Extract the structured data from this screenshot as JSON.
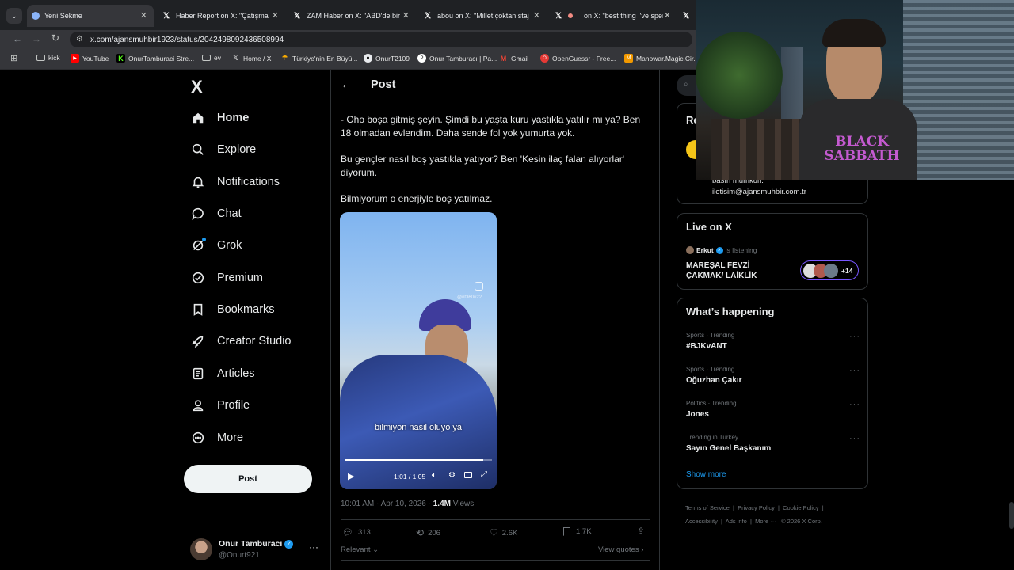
{
  "tabs": [
    {
      "title": "Yeni Sekme",
      "icon": "chrome-icon"
    },
    {
      "title": "Haber Report on X: \"Çatışma e",
      "icon": "x-logo-icon"
    },
    {
      "title": "ZAM Haber on X: \"ABD'de bir h",
      "icon": "x-logo-icon"
    },
    {
      "title": "abou on X: \"Millet çoktan staj y",
      "icon": "x-logo-icon"
    },
    {
      "title": "on X: \"best thing I've spen",
      "icon": "x-logo-icon"
    }
  ],
  "address_bar": {
    "url": "x.com/ajansmuhbir1923/status/2042498092436508994"
  },
  "bookmarks": [
    "kick",
    "YouTube",
    "OnurTamburaci Stre...",
    "ev",
    "Home / X",
    "Türkiye'nin En Büyü...",
    "OnurT2109",
    "Onur Tamburacı | Pa...",
    "Gmail",
    "OpenGuessr - Free...",
    "Manowar.Magic.Cir..."
  ],
  "sidebar": {
    "logo": "X",
    "items": [
      {
        "label": "Home",
        "icon": "home-icon"
      },
      {
        "label": "Explore",
        "icon": "search-icon"
      },
      {
        "label": "Notifications",
        "icon": "bell-icon"
      },
      {
        "label": "Chat",
        "icon": "chat-icon"
      },
      {
        "label": "Grok",
        "icon": "grok-icon"
      },
      {
        "label": "Premium",
        "icon": "premium-icon"
      },
      {
        "label": "Bookmarks",
        "icon": "bookmark-icon"
      },
      {
        "label": "Creator Studio",
        "icon": "rocket-icon"
      },
      {
        "label": "Articles",
        "icon": "article-icon"
      },
      {
        "label": "Profile",
        "icon": "person-icon"
      },
      {
        "label": "More",
        "icon": "more-circle-icon"
      }
    ],
    "post_button": "Post",
    "account": {
      "name": "Onur Tamburacı",
      "handle": "@Onurt921"
    }
  },
  "post": {
    "header": "Post",
    "paragraphs": [
      "- Oho boşa gitmiş şeyin. Şimdi bu yaşta kuru yastıkla yatılır mı ya?  Ben 18 olmadan evlendim. Daha sende fol yok yumurta yok.",
      "Bu gençler nasıl boş yastıkla yatıyor? Ben 'Kesin ilaç falan alıyorlar' diyorum.",
      "Bilmiyorum o enerjiyle boş yatılmaz."
    ],
    "video": {
      "subtitle": "bilmiyon nasil oluyo ya",
      "time": "1:01 / 1:05",
      "watermark": "@nt360ri22",
      "progress": 0.94
    },
    "timestamp": "10:01 AM · Apr 10, 2026 ·",
    "views_count": "1.4M",
    "views_label": "Views",
    "stats": {
      "replies": "313",
      "reposts": "206",
      "likes": "2.6K",
      "bookmarks": "1.7K"
    },
    "sort_label": "Relevant",
    "quotes_label": "View quotes"
  },
  "right": {
    "relevant_heading_partial": "Re",
    "contact_line1": "basın mümkün.",
    "contact_email": "iletisim@ajansmuhbir.com.tr",
    "live": {
      "heading": "Live on X",
      "host": "Erkut",
      "status": "is listening",
      "title": "MAREŞAL FEVZİ ÇAKMAK/ LAİKLİK",
      "extra_count": "+14"
    },
    "happening": {
      "heading": "What’s happening",
      "trends": [
        {
          "context": "Sports · Trending",
          "name": "#BJKvANT"
        },
        {
          "context": "Sports · Trending",
          "name": "Oğuzhan Çakır"
        },
        {
          "context": "Politics · Trending",
          "name": "Jones"
        },
        {
          "context": "Trending in Turkey",
          "name": "Sayın Genel Başkanım"
        }
      ],
      "show_more": "Show more"
    },
    "footer": [
      "Terms of Service",
      "Privacy Policy",
      "Cookie Policy",
      "Accessibility",
      "Ads info",
      "More ···",
      "© 2026 X Corp."
    ]
  },
  "webcam": {
    "shirt_text": "BLACK SABBATH"
  },
  "colors": {
    "accent": "#1d9bf0",
    "background": "#000000",
    "border": "#2f3336",
    "muted": "#71767b"
  }
}
